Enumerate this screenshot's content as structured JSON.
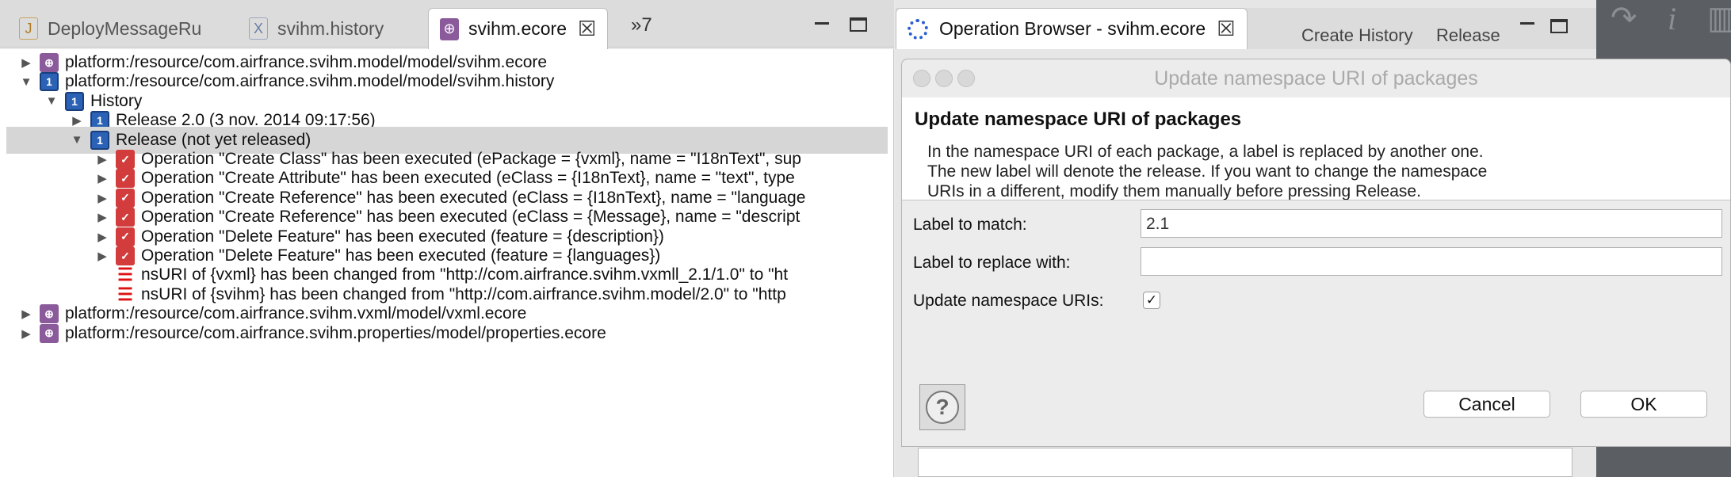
{
  "editor": {
    "tabs": [
      {
        "label": "DeployMessageRu",
        "icon": "java-file-icon"
      },
      {
        "label": "svihm.history",
        "icon": "history-file-icon"
      },
      {
        "label": "svihm.ecore",
        "icon": "ecore-file-icon",
        "active": true
      }
    ],
    "overflow_count": "»7"
  },
  "tree": [
    {
      "label": "platform:/resource/com.airfrance.svihm.model/model/svihm.ecore",
      "depth": 0,
      "expanded": false,
      "icon": "ecore-package-icon"
    },
    {
      "label": "platform:/resource/com.airfrance.svihm.model/model/svihm.history",
      "depth": 0,
      "expanded": true,
      "icon": "history-resource-icon"
    },
    {
      "label": "History",
      "depth": 1,
      "expanded": true,
      "icon": "history-icon"
    },
    {
      "label": "Release 2.0 (3 nov. 2014 09:17:56)",
      "depth": 2,
      "expanded": false,
      "icon": "release-icon"
    },
    {
      "label": "Release (not yet released)",
      "depth": 2,
      "expanded": true,
      "icon": "release-icon",
      "selected": true
    },
    {
      "label": "Operation \"Create Class\" has been executed (ePackage = {vxml}, name = \"I18nText\", sup",
      "depth": 3,
      "expanded": false,
      "icon": "operation-icon"
    },
    {
      "label": "Operation \"Create Attribute\" has been executed (eClass = {I18nText}, name = \"text\", type",
      "depth": 3,
      "expanded": false,
      "icon": "operation-icon"
    },
    {
      "label": "Operation \"Create Reference\" has been executed (eClass = {I18nText}, name = \"language",
      "depth": 3,
      "expanded": false,
      "icon": "operation-icon"
    },
    {
      "label": "Operation \"Create Reference\" has been executed (eClass = {Message}, name = \"descript",
      "depth": 3,
      "expanded": false,
      "icon": "operation-icon"
    },
    {
      "label": "Operation \"Delete Feature\" has been executed (feature = {description})",
      "depth": 3,
      "expanded": false,
      "icon": "operation-icon"
    },
    {
      "label": "Operation \"Delete Feature\" has been executed (feature = {languages})",
      "depth": 3,
      "expanded": false,
      "icon": "operation-icon"
    },
    {
      "label": "nsURI of {vxml} has been changed from \"http://com.airfrance.svihm.vxmll_2.1/1.0\" to \"ht",
      "depth": 3,
      "leaf": true,
      "icon": "uri-change-icon"
    },
    {
      "label": "nsURI of {svihm} has been changed from \"http://com.airfrance.svihm.model/2.0\" to \"http",
      "depth": 3,
      "leaf": true,
      "icon": "uri-change-icon"
    },
    {
      "label": "platform:/resource/com.airfrance.svihm.vxml/model/vxml.ecore",
      "depth": 0,
      "expanded": false,
      "icon": "ecore-package-icon"
    },
    {
      "label": "platform:/resource/com.airfrance.svihm.properties/model/properties.ecore",
      "depth": 0,
      "expanded": false,
      "icon": "ecore-package-icon"
    }
  ],
  "browser": {
    "tab_label": "Operation Browser - svihm.ecore",
    "create_history": "Create History",
    "release": "Release"
  },
  "dialog": {
    "window_title": "Update namespace URI of packages",
    "heading": "Update namespace URI of packages",
    "description_lines": [
      "In the namespace URI of each package, a label is replaced by another one.",
      "The new label will denote the release. If you want to change the namespace",
      "URIs in a different, modify them manually before pressing Release."
    ],
    "match_label": "Label to match:",
    "match_value": "2.1",
    "replace_label": "Label to replace with:",
    "replace_value": "",
    "update_label": "Update namespace URIs:",
    "update_checked": true,
    "help_glyph": "?",
    "cancel": "Cancel",
    "ok": "OK"
  },
  "colors": {
    "accent": "#2a5ed0",
    "selection": "#d6d6d6",
    "uri_marker": "#dd1111"
  }
}
